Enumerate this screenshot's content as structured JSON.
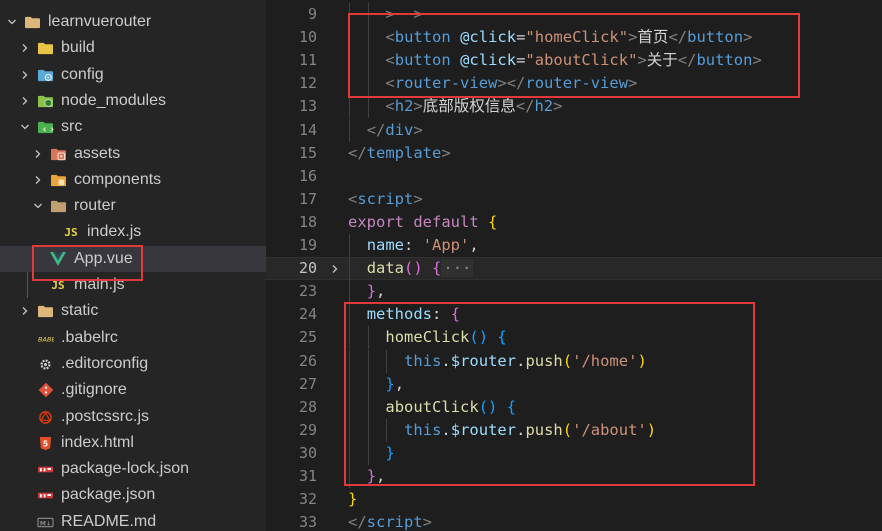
{
  "explorer": {
    "items": [
      {
        "label": "learnvuerouter",
        "depth": 0,
        "chevron": "down",
        "icon": "folder-icon",
        "icon_color": "#dcb67a"
      },
      {
        "label": "build",
        "depth": 1,
        "chevron": "right",
        "icon": "folder-icon",
        "icon_color": "#e8c547"
      },
      {
        "label": "config",
        "depth": 1,
        "chevron": "right",
        "icon": "folder-config-icon",
        "icon_color": "#5aa9d6"
      },
      {
        "label": "node_modules",
        "depth": 1,
        "chevron": "right",
        "icon": "folder-node-icon",
        "icon_color": "#8bc34a"
      },
      {
        "label": "src",
        "depth": 1,
        "chevron": "down",
        "icon": "folder-src-icon",
        "icon_color": "#4caf50"
      },
      {
        "label": "assets",
        "depth": 2,
        "chevron": "right",
        "icon": "folder-assets-icon",
        "icon_color": "#d6775a"
      },
      {
        "label": "components",
        "depth": 2,
        "chevron": "right",
        "icon": "folder-components-icon",
        "icon_color": "#e8a33b"
      },
      {
        "label": "router",
        "depth": 2,
        "chevron": "down",
        "icon": "folder-icon",
        "icon_color": "#c0a070"
      },
      {
        "label": "index.js",
        "depth": 3,
        "chevron": "none",
        "icon": "js-icon",
        "icon_color": "#e8d44d"
      },
      {
        "label": "App.vue",
        "depth": 2,
        "chevron": "none",
        "icon": "vue-icon",
        "icon_color": "#41b883",
        "selected": true
      },
      {
        "label": "main.js",
        "depth": 2,
        "chevron": "none",
        "icon": "js-icon",
        "icon_color": "#e8d44d"
      },
      {
        "label": "static",
        "depth": 1,
        "chevron": "right",
        "icon": "folder-icon",
        "icon_color": "#dcb67a"
      },
      {
        "label": ".babelrc",
        "depth": 1,
        "chevron": "none",
        "icon": "babel-icon",
        "icon_color": "#e8d44d"
      },
      {
        "label": ".editorconfig",
        "depth": 1,
        "chevron": "none",
        "icon": "gear-icon",
        "icon_color": "#d4d4d4"
      },
      {
        "label": ".gitignore",
        "depth": 1,
        "chevron": "none",
        "icon": "git-icon",
        "icon_color": "#e0513c"
      },
      {
        "label": ".postcssrc.js",
        "depth": 1,
        "chevron": "none",
        "icon": "postcss-icon",
        "icon_color": "#dd3a0a"
      },
      {
        "label": "index.html",
        "depth": 1,
        "chevron": "none",
        "icon": "html5-icon",
        "icon_color": "#e44d26"
      },
      {
        "label": "package-lock.json",
        "depth": 1,
        "chevron": "none",
        "icon": "npm-icon",
        "icon_color": "#cb3837"
      },
      {
        "label": "package.json",
        "depth": 1,
        "chevron": "none",
        "icon": "npm-icon",
        "icon_color": "#cb3837"
      },
      {
        "label": "README.md",
        "depth": 1,
        "chevron": "none",
        "icon": "markdown-icon",
        "icon_color": "#8a8a8a"
      }
    ]
  },
  "editor": {
    "current_line": "20",
    "lines": [
      {
        "num": "9",
        "tokens": [
          {
            "t": ">",
            "c": "t-punct"
          },
          {
            "t": "  ",
            "c": "t-txt"
          },
          {
            "t": ">",
            "c": "t-punct"
          }
        ],
        "indent": 2
      },
      {
        "num": "10",
        "tokens": [
          {
            "t": "<",
            "c": "t-punct"
          },
          {
            "t": "button",
            "c": "t-tag"
          },
          {
            "t": " ",
            "c": "t-txt"
          },
          {
            "t": "@click",
            "c": "t-attr"
          },
          {
            "t": "=",
            "c": "t-txt"
          },
          {
            "t": "\"homeClick\"",
            "c": "t-str"
          },
          {
            "t": ">",
            "c": "t-punct"
          },
          {
            "t": "首页",
            "c": "t-txt"
          },
          {
            "t": "</",
            "c": "t-punct"
          },
          {
            "t": "button",
            "c": "t-tag"
          },
          {
            "t": ">",
            "c": "t-punct"
          }
        ],
        "indent": 2
      },
      {
        "num": "11",
        "tokens": [
          {
            "t": "<",
            "c": "t-punct"
          },
          {
            "t": "button",
            "c": "t-tag"
          },
          {
            "t": " ",
            "c": "t-txt"
          },
          {
            "t": "@click",
            "c": "t-attr"
          },
          {
            "t": "=",
            "c": "t-txt"
          },
          {
            "t": "\"aboutClick\"",
            "c": "t-str"
          },
          {
            "t": ">",
            "c": "t-punct"
          },
          {
            "t": "关于",
            "c": "t-txt"
          },
          {
            "t": "</",
            "c": "t-punct"
          },
          {
            "t": "button",
            "c": "t-tag"
          },
          {
            "t": ">",
            "c": "t-punct"
          }
        ],
        "indent": 2
      },
      {
        "num": "12",
        "tokens": [
          {
            "t": "<",
            "c": "t-punct"
          },
          {
            "t": "router-view",
            "c": "t-tag"
          },
          {
            "t": "></",
            "c": "t-punct"
          },
          {
            "t": "router-view",
            "c": "t-tag"
          },
          {
            "t": ">",
            "c": "t-punct"
          }
        ],
        "indent": 2
      },
      {
        "num": "13",
        "tokens": [
          {
            "t": "<",
            "c": "t-punct"
          },
          {
            "t": "h2",
            "c": "t-tag"
          },
          {
            "t": ">",
            "c": "t-punct"
          },
          {
            "t": "底部版权信息",
            "c": "t-txt"
          },
          {
            "t": "</",
            "c": "t-punct"
          },
          {
            "t": "h2",
            "c": "t-tag"
          },
          {
            "t": ">",
            "c": "t-punct"
          }
        ],
        "indent": 2
      },
      {
        "num": "14",
        "tokens": [
          {
            "t": "</",
            "c": "t-punct"
          },
          {
            "t": "div",
            "c": "t-tag"
          },
          {
            "t": ">",
            "c": "t-punct"
          }
        ],
        "indent": 1
      },
      {
        "num": "15",
        "tokens": [
          {
            "t": "</",
            "c": "t-punct"
          },
          {
            "t": "template",
            "c": "t-tag"
          },
          {
            "t": ">",
            "c": "t-punct"
          }
        ],
        "indent": 0
      },
      {
        "num": "16",
        "tokens": [],
        "indent": 0
      },
      {
        "num": "17",
        "tokens": [
          {
            "t": "<",
            "c": "t-punct"
          },
          {
            "t": "script",
            "c": "t-tag"
          },
          {
            "t": ">",
            "c": "t-punct"
          }
        ],
        "indent": 0
      },
      {
        "num": "18",
        "tokens": [
          {
            "t": "export",
            "c": "t-kw2"
          },
          {
            "t": " ",
            "c": "t-txt"
          },
          {
            "t": "default",
            "c": "t-kw2"
          },
          {
            "t": " ",
            "c": "t-txt"
          },
          {
            "t": "{",
            "c": "t-br1"
          }
        ],
        "indent": 0
      },
      {
        "num": "19",
        "tokens": [
          {
            "t": "name",
            "c": "t-prop"
          },
          {
            "t": ": ",
            "c": "t-txt"
          },
          {
            "t": "'App'",
            "c": "t-str"
          },
          {
            "t": ",",
            "c": "t-txt"
          }
        ],
        "indent": 1
      },
      {
        "num": "20",
        "tokens": [
          {
            "t": "data",
            "c": "t-fn"
          },
          {
            "t": "()",
            "c": "t-br2"
          },
          {
            "t": " ",
            "c": "t-txt"
          },
          {
            "t": "{",
            "c": "t-br2"
          },
          {
            "t": "···",
            "c": "fold-ellipsis"
          }
        ],
        "indent": 1,
        "fold": true
      },
      {
        "num": "23",
        "tokens": [
          {
            "t": "}",
            "c": "t-br2"
          },
          {
            "t": ",",
            "c": "t-txt"
          }
        ],
        "indent": 1
      },
      {
        "num": "24",
        "tokens": [
          {
            "t": "methods",
            "c": "t-prop"
          },
          {
            "t": ": ",
            "c": "t-txt"
          },
          {
            "t": "{",
            "c": "t-br2"
          }
        ],
        "indent": 1
      },
      {
        "num": "25",
        "tokens": [
          {
            "t": "homeClick",
            "c": "t-fn"
          },
          {
            "t": "()",
            "c": "t-br3"
          },
          {
            "t": " ",
            "c": "t-txt"
          },
          {
            "t": "{",
            "c": "t-br3"
          }
        ],
        "indent": 2
      },
      {
        "num": "26",
        "tokens": [
          {
            "t": "this",
            "c": "t-kw"
          },
          {
            "t": ".",
            "c": "t-txt"
          },
          {
            "t": "$router",
            "c": "t-prop"
          },
          {
            "t": ".",
            "c": "t-txt"
          },
          {
            "t": "push",
            "c": "t-fn"
          },
          {
            "t": "(",
            "c": "t-br1"
          },
          {
            "t": "'/home'",
            "c": "t-str"
          },
          {
            "t": ")",
            "c": "t-br1"
          }
        ],
        "indent": 3
      },
      {
        "num": "27",
        "tokens": [
          {
            "t": "}",
            "c": "t-br3"
          },
          {
            "t": ",",
            "c": "t-txt"
          }
        ],
        "indent": 2
      },
      {
        "num": "28",
        "tokens": [
          {
            "t": "aboutClick",
            "c": "t-fn"
          },
          {
            "t": "()",
            "c": "t-br3"
          },
          {
            "t": " ",
            "c": "t-txt"
          },
          {
            "t": "{",
            "c": "t-br3"
          }
        ],
        "indent": 2
      },
      {
        "num": "29",
        "tokens": [
          {
            "t": "this",
            "c": "t-kw"
          },
          {
            "t": ".",
            "c": "t-txt"
          },
          {
            "t": "$router",
            "c": "t-prop"
          },
          {
            "t": ".",
            "c": "t-txt"
          },
          {
            "t": "push",
            "c": "t-fn"
          },
          {
            "t": "(",
            "c": "t-br1"
          },
          {
            "t": "'/about'",
            "c": "t-str"
          },
          {
            "t": ")",
            "c": "t-br1"
          }
        ],
        "indent": 3
      },
      {
        "num": "30",
        "tokens": [
          {
            "t": "}",
            "c": "t-br3"
          }
        ],
        "indent": 2
      },
      {
        "num": "31",
        "tokens": [
          {
            "t": "}",
            "c": "t-br2"
          },
          {
            "t": ",",
            "c": "t-txt"
          }
        ],
        "indent": 1
      },
      {
        "num": "32",
        "tokens": [
          {
            "t": "}",
            "c": "t-br1"
          }
        ],
        "indent": 0
      },
      {
        "num": "33",
        "tokens": [
          {
            "t": "</",
            "c": "t-punct"
          },
          {
            "t": "script",
            "c": "t-tag"
          },
          {
            "t": ">",
            "c": "t-punct"
          }
        ],
        "indent": 0
      }
    ]
  },
  "colors": {
    "highlight_box": "#e03a3a",
    "sidebar_bg": "#252526",
    "editor_bg": "#1e1e1e",
    "selected_bg": "#37373d"
  }
}
